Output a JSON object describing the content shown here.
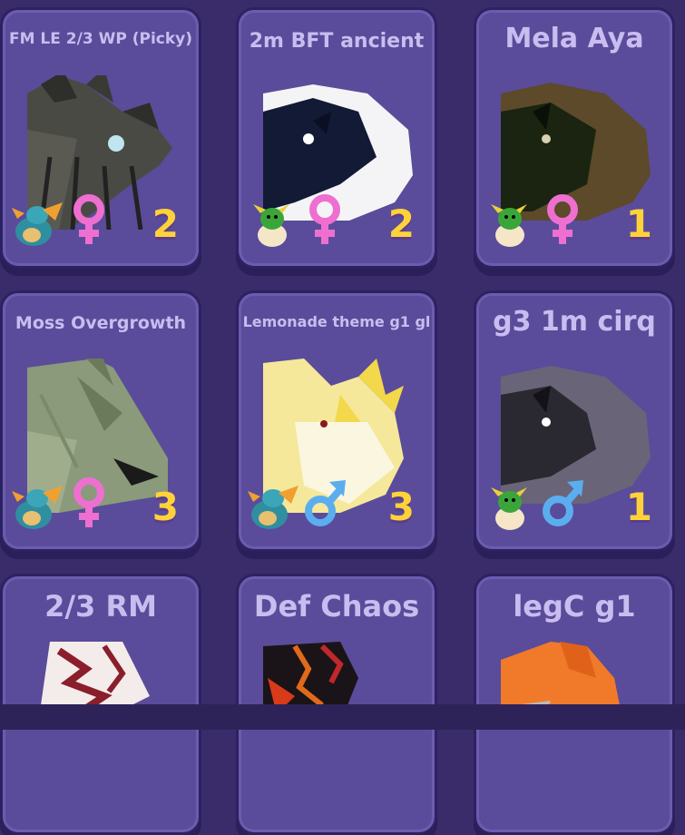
{
  "colors": {
    "background": "#3a2c6b",
    "card": "#5a4c9a",
    "title": "#c9bdf0",
    "count": "#ffd23a",
    "female_icon": "#ee6fd0",
    "male_icon": "#5aaef0"
  },
  "cards": [
    {
      "title": "FM LE 2/3 WP (Picky)",
      "age_icon": "adult-dragon-icon",
      "gender_icon": "female-icon",
      "count": "2"
    },
    {
      "title": "2m BFT ancient",
      "age_icon": "hatchling-egg-icon",
      "gender_icon": "female-icon",
      "count": "2"
    },
    {
      "title": "Mela Aya",
      "age_icon": "hatchling-egg-icon",
      "gender_icon": "female-icon",
      "count": "1"
    },
    {
      "title": "Moss Overgrowth",
      "age_icon": "adult-dragon-icon",
      "gender_icon": "female-icon",
      "count": "3"
    },
    {
      "title": "Lemonade theme g1 gl",
      "age_icon": "adult-dragon-icon",
      "gender_icon": "male-icon",
      "count": "3"
    },
    {
      "title": "g3 1m cirq",
      "age_icon": "hatchling-egg-icon",
      "gender_icon": "male-icon",
      "count": "1"
    },
    {
      "title": "2/3 RM"
    },
    {
      "title": "Def Chaos"
    },
    {
      "title": "legC g1"
    }
  ]
}
